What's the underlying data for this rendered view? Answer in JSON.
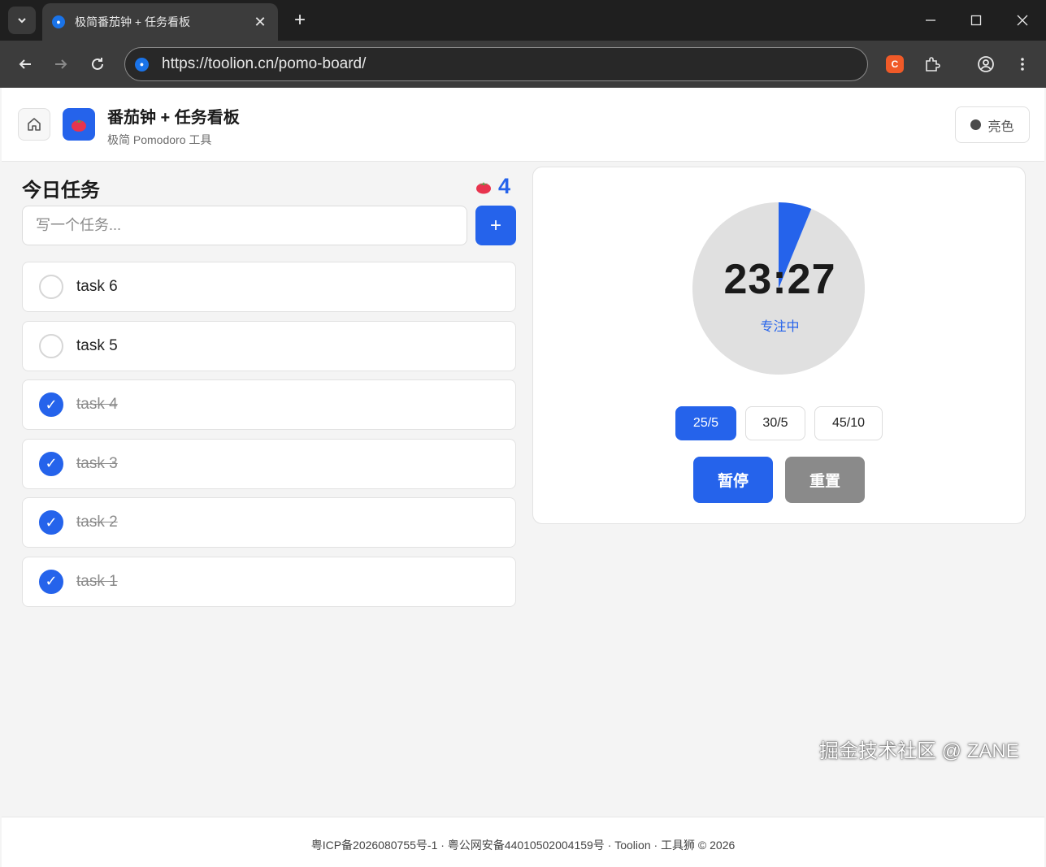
{
  "browser": {
    "tab_title": "极简番茄钟 + 任务看板",
    "url": "https://toolion.cn/pomo-board/",
    "icons": {
      "tab_dropdown": "chevron-down-icon",
      "favicon": "site-favicon-icon",
      "close": "close-icon",
      "new_tab": "plus-icon",
      "back": "back-arrow-icon",
      "forward": "forward-arrow-icon",
      "reload": "reload-icon",
      "extension": "puzzle-icon",
      "profile": "profile-icon",
      "menu": "kebab-menu-icon"
    }
  },
  "header": {
    "title": "番茄钟 + 任务看板",
    "subtitle": "极简 Pomodoro 工具",
    "theme_label": "亮色",
    "icons": {
      "home": "home-icon",
      "logo": "tomato-icon",
      "theme": "theme-dot-icon"
    }
  },
  "tasks": {
    "heading": "今日任务",
    "pomodoro_count": "4",
    "input_placeholder": "写一个任务...",
    "add_label": "+",
    "check_mark": "✓",
    "items": [
      {
        "label": "task 6",
        "done": false
      },
      {
        "label": "task 5",
        "done": false
      },
      {
        "label": "task 4",
        "done": true
      },
      {
        "label": "task 3",
        "done": true
      },
      {
        "label": "task 2",
        "done": true
      },
      {
        "label": "task 1",
        "done": true
      }
    ]
  },
  "timer": {
    "time": "23:27",
    "status": "专注中",
    "elapsed_fraction": 0.062,
    "presets": [
      {
        "label": "25/5",
        "active": true
      },
      {
        "label": "30/5",
        "active": false
      },
      {
        "label": "45/10",
        "active": false
      }
    ],
    "pause_label": "暂停",
    "reset_label": "重置",
    "colors": {
      "accent": "#2563eb",
      "track": "#e0e0e0",
      "reset": "#8a8a8a"
    }
  },
  "footer": {
    "text": "粤ICP备2026080755号-1 · 粤公网安备44010502004159号 · Toolion · 工具狮 © 2026"
  },
  "watermark": "掘金技术社区 @ ZANE"
}
